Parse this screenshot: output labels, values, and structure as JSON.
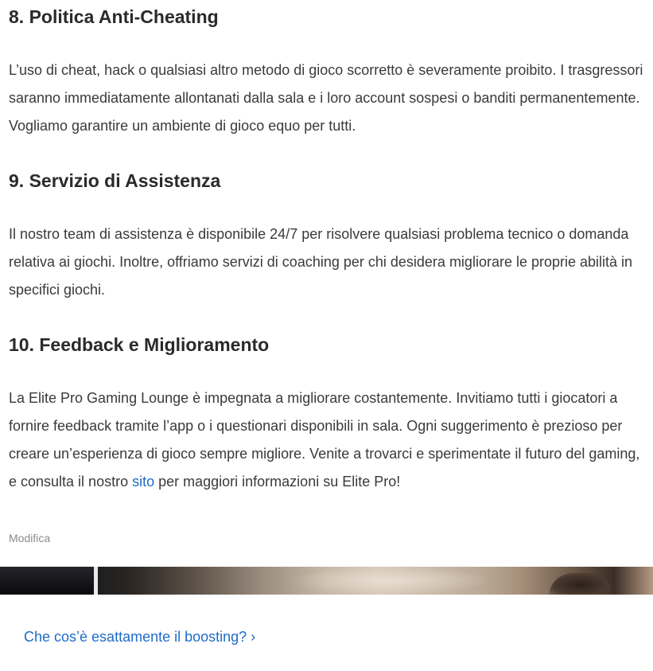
{
  "sections": [
    {
      "heading": "8. Politica Anti-Cheating",
      "body": "L’uso di cheat, hack o qualsiasi altro metodo di gioco scorretto è severamente proibito. I trasgressori saranno immediatamente allontanati dalla sala e i loro account sospesi o banditi permanentemente. Vogliamo garantire un ambiente di gioco equo per tutti."
    },
    {
      "heading": "9. Servizio di Assistenza",
      "body": "Il nostro team di assistenza è disponibile 24/7 per risolvere qualsiasi problema tecnico o domanda relativa ai giochi. Inoltre, offriamo servizi di coaching per chi desidera migliorare le proprie abilità in specifici giochi."
    },
    {
      "heading": "10. Feedback e Miglioramento",
      "body_before_link": "La Elite Pro Gaming Lounge è impegnata a migliorare costantemente. Invitiamo tutti i giocatori a fornire feedback tramite l’app o i questionari disponibili in sala. Ogni suggerimento è prezioso per creare un’esperienza di gioco sempre migliore. Venite a trovarci e sperimentate il futuro del gaming, e consulta il nostro ",
      "link_text": "sito",
      "body_after_link": " per maggiori informazioni su Elite Pro!"
    }
  ],
  "edit_label": "Modifica",
  "next_article": {
    "label": "Che cos’è esattamente il boosting? ›"
  },
  "colors": {
    "link": "#1e6cc6",
    "heading": "#2a2a2a",
    "body_text": "#3a3a3a",
    "muted": "#8a8a8a"
  }
}
